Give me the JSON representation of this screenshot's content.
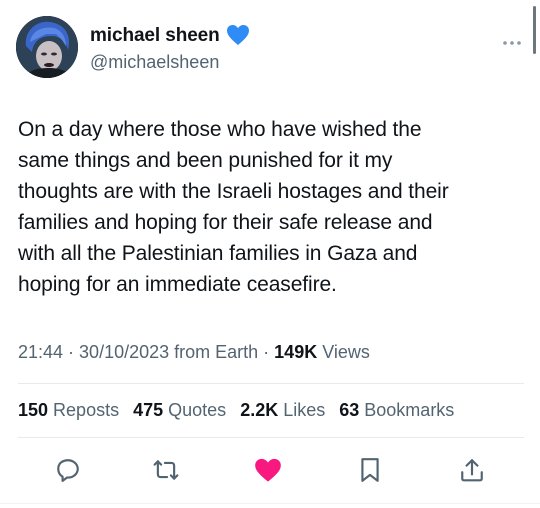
{
  "author": {
    "display_name": "michael sheen",
    "handle": "@michaelsheen",
    "verified_color": "#1d9bf0"
  },
  "tweet": {
    "text": "On a day where those who have wished the\nsame things and been punished for it my\nthoughts are with the Israeli hostages and their\nfamilies and hoping for their safe release and\nwith all the Palestinian families in Gaza and\nhoping for an immediate ceasefire."
  },
  "meta": {
    "time": "21:44",
    "sep1": "·",
    "date": "30/10/2023",
    "source": "from Earth",
    "sep2": "·",
    "views_count": "149K",
    "views_label": "Views"
  },
  "stats": {
    "reposts_count": "150",
    "reposts_label": "Reposts",
    "quotes_count": "475",
    "quotes_label": "Quotes",
    "likes_count": "2.2K",
    "likes_label": "Likes",
    "bookmarks_count": "63",
    "bookmarks_label": "Bookmarks"
  },
  "actions": {
    "reply_icon": "reply-icon",
    "repost_icon": "repost-icon",
    "like_icon": "heart-icon",
    "like_active": true,
    "like_color": "#f91880",
    "bookmark_icon": "bookmark-icon",
    "share_icon": "share-icon"
  },
  "colors": {
    "text_primary": "#0f1419",
    "text_secondary": "#536471",
    "accent": "#1d9bf0"
  }
}
